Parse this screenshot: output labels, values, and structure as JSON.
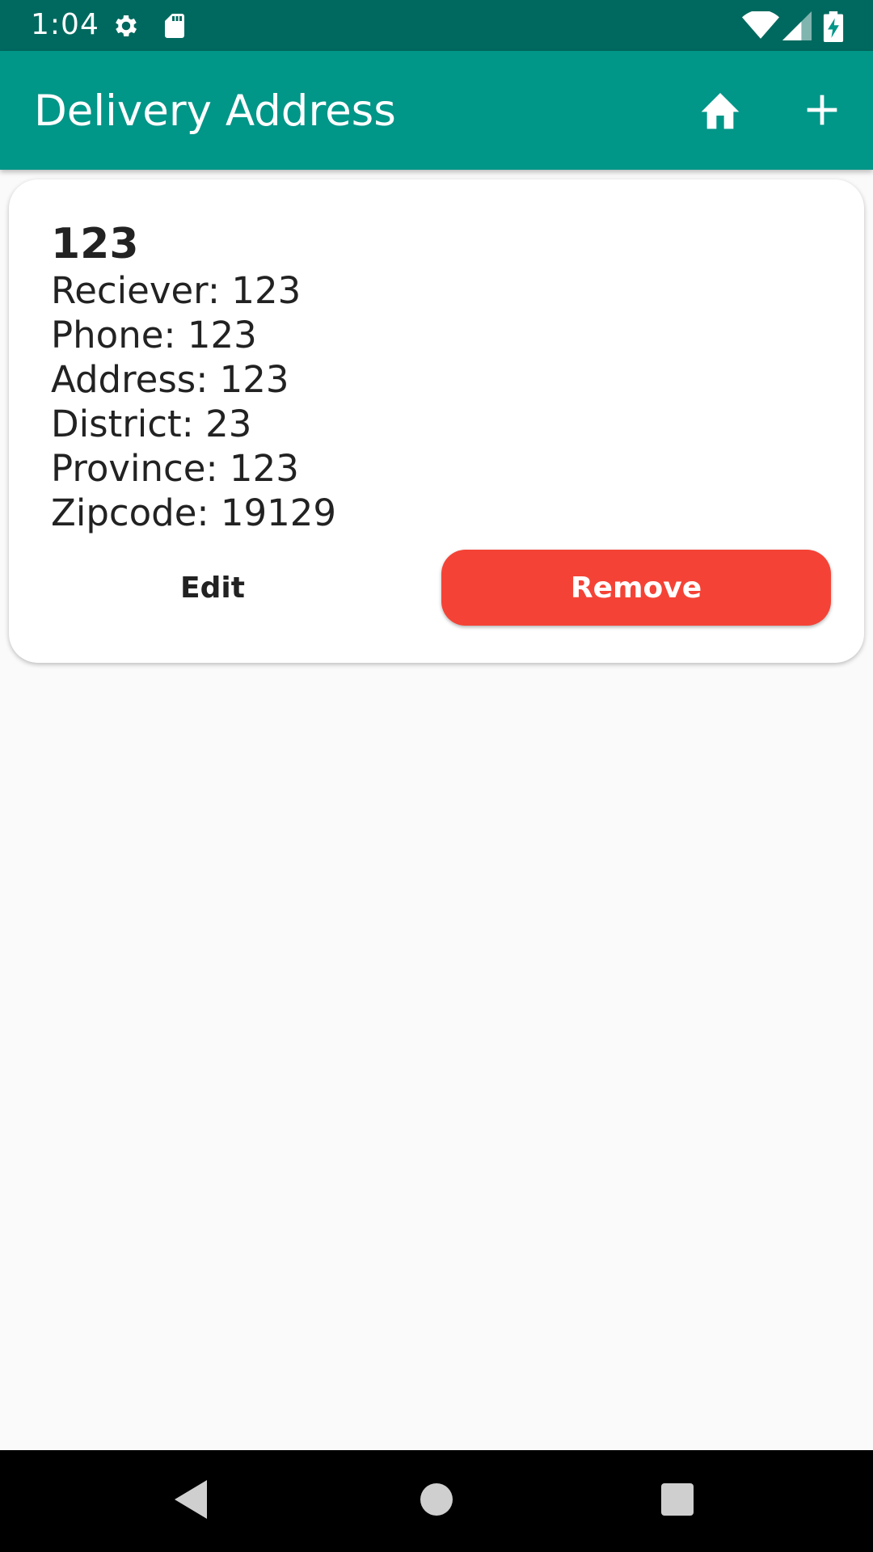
{
  "status_bar": {
    "time": "1:04",
    "icons": [
      "settings-icon",
      "sd-card-icon",
      "wifi-icon",
      "signal-icon",
      "battery-charging-icon"
    ]
  },
  "app_bar": {
    "title": "Delivery Address",
    "actions": [
      "home-icon",
      "add-icon"
    ],
    "background": "#009688",
    "status_background": "#00695f"
  },
  "address_card": {
    "title": "123",
    "lines": [
      "Reciever: 123",
      "Phone: 123",
      "Address: 123",
      "District: 23",
      "Province: 123",
      "Zipcode: 19129"
    ],
    "edit_label": "Edit",
    "remove_label": "Remove",
    "remove_color": "#f44336"
  },
  "nav_bar": {
    "buttons": [
      "back-icon",
      "home-circle-icon",
      "recents-icon"
    ]
  }
}
